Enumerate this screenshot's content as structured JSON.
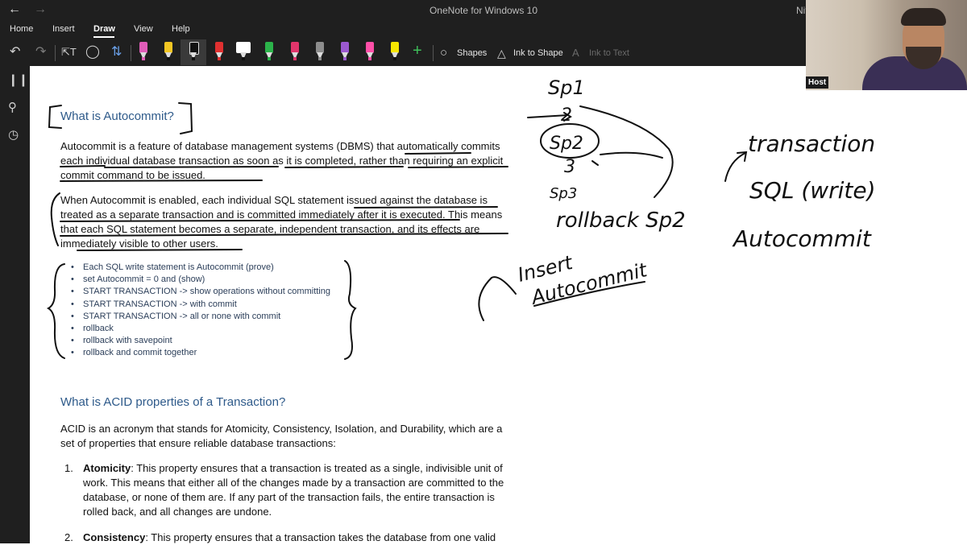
{
  "titlebar": {
    "title": "OneNote for Windows 10",
    "user": "Nit"
  },
  "menu": {
    "items": [
      "Home",
      "Insert",
      "Draw",
      "View",
      "Help"
    ],
    "active": "Draw"
  },
  "toolbar": {
    "shapes_label": "Shapes",
    "ink_to_shape_label": "Ink to Shape",
    "ink_to_text_label": "Ink to Text",
    "pen_colors": [
      "#e05cb8",
      "#f3c623",
      "#111111",
      "#e03030",
      "#111111",
      "#2bb34a",
      "#e0356b",
      "#8d8d8d",
      "#9b59d0",
      "#ff4fa8",
      "#f5e500"
    ]
  },
  "section1": {
    "heading": "What is Autocommit?",
    "para1": "Autocommit is a feature of database management systems (DBMS) that automatically commits each individual database transaction as soon as it is completed, rather than requiring an explicit commit command to be issued.",
    "para2": "When Autocommit is enabled, each individual SQL statement issued against the database is treated as a separate transaction and is committed immediately after it is executed. This means that each SQL statement becomes a separate, independent transaction, and its effects are immediately visible to other users.",
    "bullets": [
      "Each SQL write statement is Autocommit (prove)",
      "set Autocommit = 0 and (show)",
      "START TRANSACTION -> show operations without committing",
      "START TRANSACTION -> with commit",
      "START TRANSACTION -> all or none with commit",
      "rollback",
      "rollback with savepoint",
      "rollback and commit together"
    ]
  },
  "section2": {
    "heading": "What is ACID properties of a Transaction?",
    "intro": "ACID is an acronym that stands for Atomicity, Consistency, Isolation, and Durability, which are a set of properties that ensure reliable database transactions:",
    "items": [
      {
        "num": "1.",
        "term": "Atomicity",
        "text": ": This property ensures that a transaction is treated as a single, indivisible unit of work. This means that either all of the changes made by a transaction are committed to the database, or none of them are. If any part of the transaction fails, the entire transaction is rolled back, and all changes are undone."
      },
      {
        "num": "2.",
        "term": "Consistency",
        "text": ": This property ensures that a transaction takes the database from one valid"
      }
    ]
  },
  "ink_notes": [
    "Sp1",
    "Sp2",
    "2",
    "3",
    "Sp3",
    "rollback Sp2",
    "transaction",
    "SQL (write)",
    "Autocommit",
    "Insert",
    "Autocommit"
  ],
  "webcam": {
    "label": "Host"
  }
}
